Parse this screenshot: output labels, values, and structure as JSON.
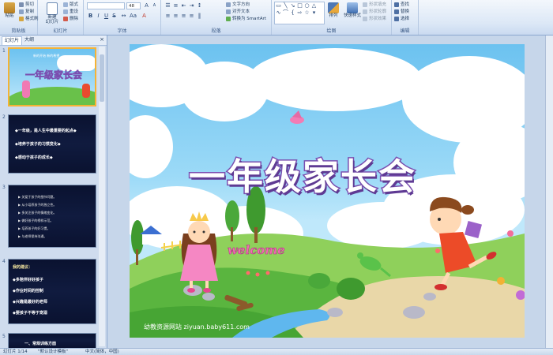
{
  "ribbon": {
    "groups": [
      "剪贴板",
      "幻灯片",
      "字体",
      "段落",
      "绘图",
      "编辑"
    ],
    "paste": "粘贴",
    "cut": "剪切",
    "copy": "复制",
    "format_painter": "格式刷",
    "new_slide": "新建\n幻灯片",
    "layout": "版式",
    "reset": "重设",
    "delete": "删除",
    "font_size": "48",
    "text_direction": "文字方向",
    "align_text": "对齐文本",
    "convert_smartart": "转换为 SmartArt",
    "arrange": "排列",
    "quick_styles": "快速样式",
    "shape_fill": "形状填充",
    "shape_outline": "形状轮廓",
    "shape_effects": "形状效果",
    "find": "查找",
    "replace": "替换",
    "select": "选择"
  },
  "panel": {
    "tab_slides": "幻灯片",
    "tab_outline": "大纲",
    "close": "×",
    "slides": [
      {
        "num": "1",
        "title": "一年级家长会",
        "subtitle": "新的开始 新的希望"
      },
      {
        "num": "2",
        "bullets": [
          "◆一年级，是人生中最重要的起点◆",
          "◆培养于孩子的习惯变化◆",
          "◆感动于孩子的成长◆"
        ]
      },
      {
        "num": "3",
        "lines": [
          "▶ 关爱于孩子的细节问题。",
          "▶ 从小培养孩子的独立性。",
          "▶ 多关注孩子的情绪变化。",
          "▶ 做好孩子的榜样示范。",
          "▶ 培养孩子的好习惯。",
          "▶ 与老师保持沟通。"
        ]
      },
      {
        "num": "4",
        "heading": "我的建议：",
        "bullets": [
          "◆多陪伴好好孩子",
          "◆作业时间的控制",
          "◆兴趣是最好的老师",
          "◆要孩子不等于宠溺"
        ]
      },
      {
        "num": "5",
        "heading": "一、常规训练方面"
      }
    ]
  },
  "slide": {
    "subtitle": "新的开始 新的希望",
    "title": "一年级家长会",
    "welcome": "welcome",
    "footer": "幼教资源网站 ziyuan.baby611.com"
  },
  "status": {
    "slide_info": "幻灯片 1/14",
    "theme": "\"默认设计模板\"",
    "language": "中文(简体，中国)"
  },
  "colors": {
    "title_fill": "#ffffff",
    "title_outline": "#7a4fb0",
    "subtitle": "#ffffff",
    "selection": "#f5b335"
  }
}
